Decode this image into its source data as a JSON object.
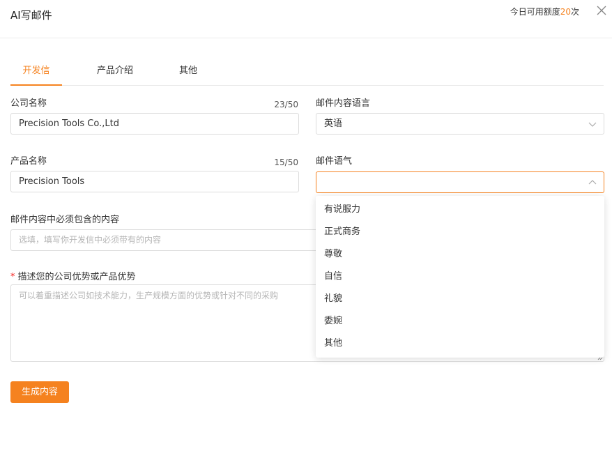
{
  "dialog": {
    "title": "AI写邮件",
    "quota_prefix": "今日可用额度",
    "quota_value": "20",
    "quota_suffix": "次",
    "close_icon": "close-icon"
  },
  "tabs": [
    {
      "label": "开发信",
      "active": true
    },
    {
      "label": "产品介绍",
      "active": false
    },
    {
      "label": "其他",
      "active": false
    }
  ],
  "form": {
    "company_name": {
      "label": "公司名称",
      "value": "Precision Tools Co.,Ltd",
      "counter": "23/50"
    },
    "email_language": {
      "label": "邮件内容语言",
      "value": "英语"
    },
    "product_name": {
      "label": "产品名称",
      "value": "Precision Tools",
      "counter": "15/50"
    },
    "email_tone": {
      "label": "邮件语气",
      "value": ""
    },
    "must_include": {
      "label": "邮件内容中必须包含的内容",
      "placeholder": "选填，填写你开发信中必须带有的内容"
    },
    "advantages": {
      "required_mark": "*",
      "label": "描述您的公司优势或产品优势",
      "placeholder": "可以着重描述公司如技术能力，生产规模方面的优势或针对不同的采购"
    }
  },
  "tone_options": [
    "有说服力",
    "正式商务",
    "尊敬",
    "自信",
    "礼貌",
    "委婉",
    "其他"
  ],
  "submit_label": "生成内容",
  "colors": {
    "accent": "#f5821f",
    "border": "#dcdcdc",
    "placeholder": "#b5b5b5"
  }
}
